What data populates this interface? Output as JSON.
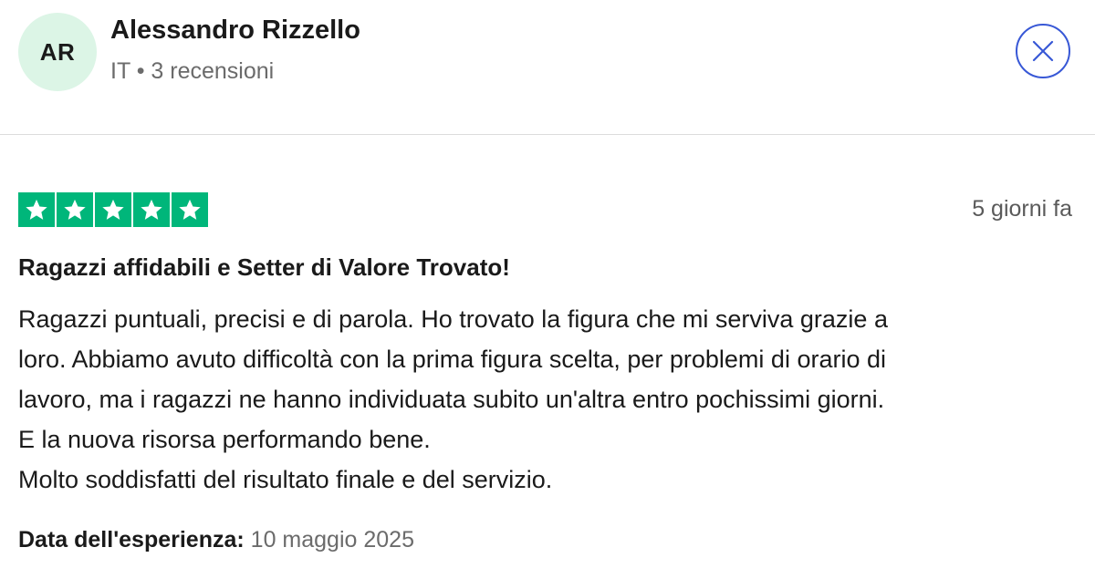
{
  "reviewer": {
    "initials": "AR",
    "name": "Alessandro Rizzello",
    "meta": "IT • 3 recensioni",
    "avatar_bg": "#dcf5e6"
  },
  "close_button": {
    "icon": "close-icon",
    "color": "#3858d6"
  },
  "review": {
    "rating": 5,
    "rating_max": 5,
    "star_color": "#00b67a",
    "date": "5 giorni fa",
    "title": "Ragazzi affidabili e Setter di Valore Trovato!",
    "body_lines": [
      "Ragazzi puntuali, precisi e di parola. Ho trovato la figura che mi serviva grazie a",
      "loro. Abbiamo avuto difficoltà con la prima figura scelta, per problemi di orario di",
      "lavoro, ma i ragazzi ne hanno individuata subito un'altra entro pochissimi giorni.",
      "E la nuova risorsa performando bene.",
      "Molto soddisfatti del risultato finale e del servizio."
    ],
    "experience_label": "Data dell'esperienza:",
    "experience_date": "10 maggio 2025"
  }
}
